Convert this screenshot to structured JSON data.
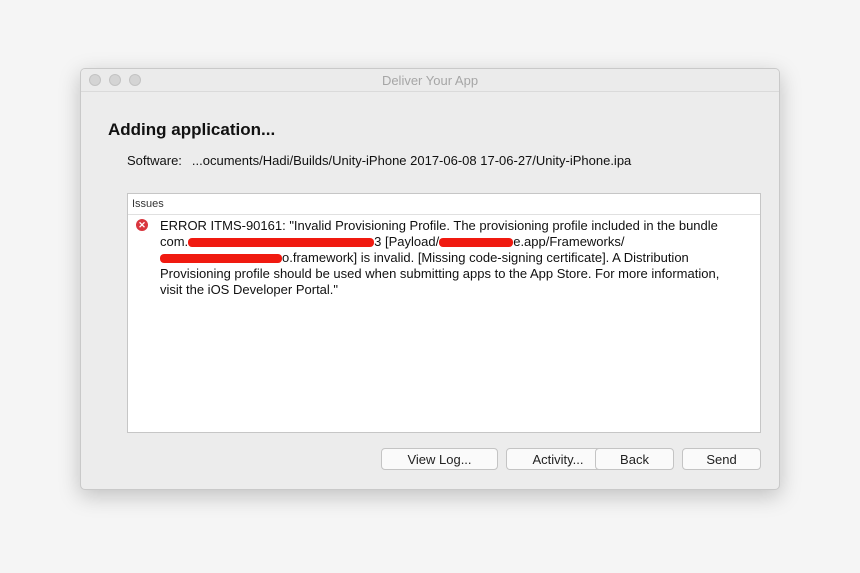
{
  "window": {
    "title": "Deliver Your App"
  },
  "heading": "Adding application...",
  "software": {
    "label": "Software:",
    "value": "...ocuments/Hadi/Builds/Unity-iPhone 2017-06-08 17-06-27/Unity-iPhone.ipa"
  },
  "issues": {
    "header": "Issues",
    "items": [
      {
        "icon": "error-icon",
        "line1": "ERROR ITMS-90161: \"Invalid Provisioning Profile. The provisioning profile included in the bundle",
        "line2_a": "com.",
        "line2_b": "3 [Payload/",
        "line2_c": "e.app/Frameworks/",
        "line3_a": "o.framework] is invalid. [Missing code-signing certificate]. A Distribution",
        "line4": "Provisioning profile should be used when submitting apps to the App Store. For more information,",
        "line5": "visit the iOS Developer Portal.\""
      }
    ]
  },
  "buttons": {
    "view_log": "View Log...",
    "activity": "Activity...",
    "back": "Back",
    "send": "Send"
  },
  "colors": {
    "error": "#d9363e",
    "redaction": "#f01a10"
  }
}
